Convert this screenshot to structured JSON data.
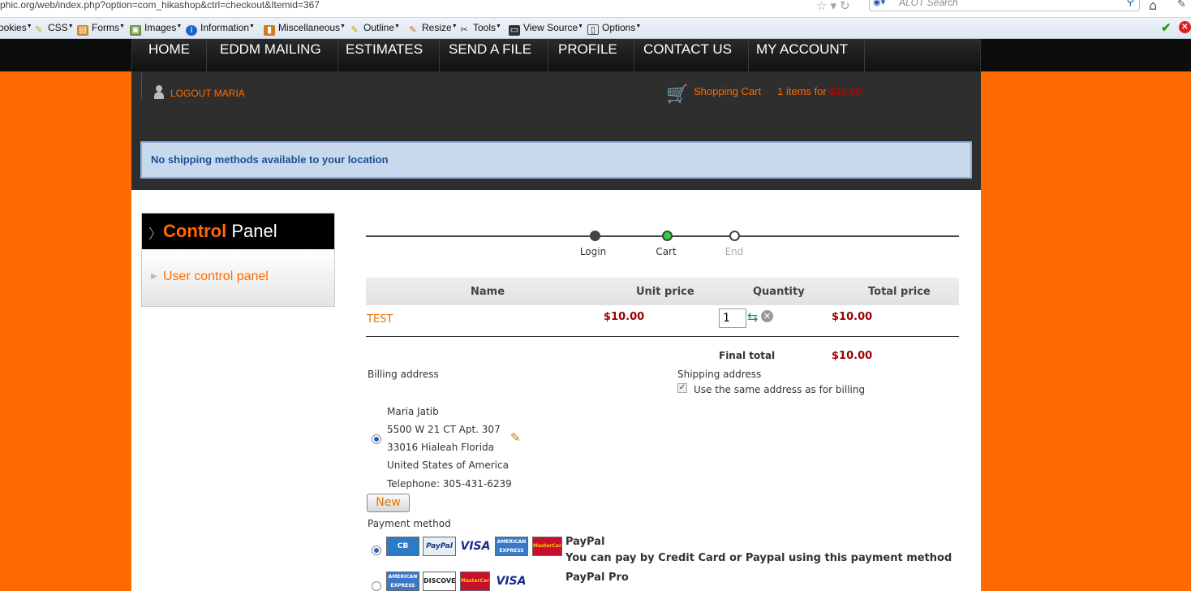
{
  "browser": {
    "url": "phic.org/web/index.php?option=com_hikashop&ctrl=checkout&Itemid=367",
    "search_placeholder": "ALOT Search"
  },
  "toolbar": {
    "items": [
      "ookies",
      "CSS",
      "Forms",
      "Images",
      "Information",
      "Miscellaneous",
      "Outline",
      "Resize",
      "Tools",
      "View Source",
      "Options"
    ]
  },
  "nav": {
    "items": [
      "HOME",
      "EDDM MAILING",
      "ESTIMATES",
      "SEND A FILE",
      "PROFILE",
      "CONTACT US",
      "MY ACCOUNT"
    ]
  },
  "header": {
    "logout": "LOGOUT MARIA",
    "cart_label": "Shopping Cart",
    "cart_count_prefix": "1 items for",
    "cart_amount": "$10.00",
    "alert": "No shipping methods available to your location"
  },
  "control_panel": {
    "title_accent": "Control",
    "title_rest": "Panel",
    "link": "User control panel"
  },
  "steps": [
    {
      "label": "Login",
      "state": "done"
    },
    {
      "label": "Cart",
      "state": "current"
    },
    {
      "label": "End",
      "state": "todo"
    }
  ],
  "cart": {
    "headers": {
      "name": "Name",
      "unit_price": "Unit price",
      "quantity": "Quantity",
      "total_price": "Total price"
    },
    "row": {
      "name": "TEST",
      "unit_price": "$10.00",
      "quantity": "1",
      "total": "$10.00"
    },
    "final_label": "Final total",
    "final_value": "$10.00"
  },
  "billing": {
    "label": "Billing address",
    "name": "Maria Jatib",
    "street": "5500 W 21 CT Apt. 307",
    "city": "33016 Hialeah Florida",
    "country": "United States of America",
    "telephone": "Telephone: 305-431-6239",
    "new_button": "New"
  },
  "shipping": {
    "label": "Shipping address",
    "same_as_billing": "Use the same address as for billing"
  },
  "payment": {
    "label": "Payment method",
    "methods": [
      {
        "name": "PayPal",
        "description": "You can pay by Credit Card or Paypal using this payment method",
        "cards": [
          "CB",
          "PayPal",
          "VISA",
          "AMERICAN EXPRESS",
          "MasterCard"
        ]
      },
      {
        "name": "PayPal Pro",
        "cards": [
          "AMERICAN EXPRESS",
          "DISCOVER",
          "MasterCard",
          "VISA"
        ]
      }
    ]
  }
}
